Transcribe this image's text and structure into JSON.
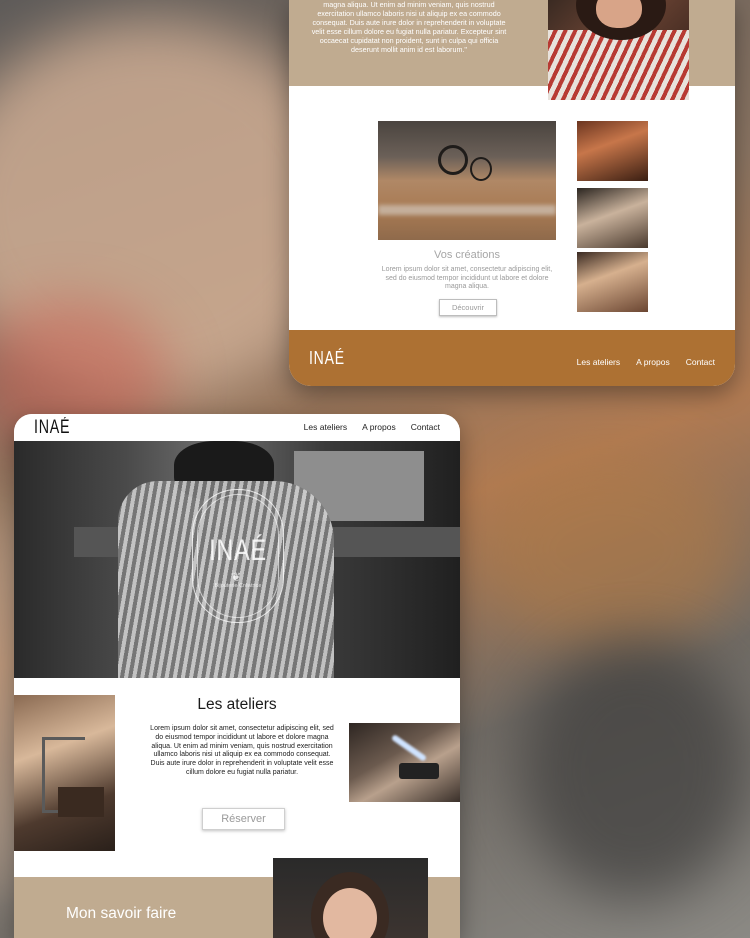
{
  "top_mockup": {
    "about_text": "magna aliqua. Ut enim ad minim veniam, quis nostrud exercitation ullamco laboris nisi ut aliquip ex ea commodo consequat. Duis aute irure dolor in reprehenderit in voluptate velit esse cillum dolore eu fugiat nulla pariatur. Excepteur sint occaecat cupidatat non proident, sunt in culpa qui officia deserunt mollit anim id est laborum.\"",
    "creations_title": "Vos créations",
    "creations_text": "Lorem ipsum dolor sit amet, consectetur adipiscing elit, sed do eiusmod tempor incididunt ut labore et dolore magna aliqua.",
    "discover_label": "Découvrir",
    "footer": {
      "logo": "INAÉ",
      "nav": [
        "Les ateliers",
        "A propos",
        "Contact"
      ]
    }
  },
  "bottom_mockup": {
    "logo": "INAÉ",
    "nav": [
      "Les ateliers",
      "A propos",
      "Contact"
    ],
    "hero_crest": {
      "name": "INAÉ",
      "subtitle": "Bijouterie Créatrice"
    },
    "ateliers_title": "Les ateliers",
    "ateliers_text": "Lorem ipsum dolor sit amet, consectetur adipiscing elit, sed do eiusmod tempor incididunt ut labore et dolore magna aliqua. Ut enim ad minim veniam, quis nostrud exercitation ullamco laboris nisi ut aliquip ex ea commodo consequat. Duis aute irure dolor in reprehenderit in voluptate velit esse cillum dolore eu fugiat nulla pariatur.",
    "reserve_label": "Réserver",
    "savoir_title": "Mon savoir faire"
  },
  "colors": {
    "sand": "#c0ab90",
    "copper": "#ad7133",
    "button_text": "#9a9a9a"
  }
}
